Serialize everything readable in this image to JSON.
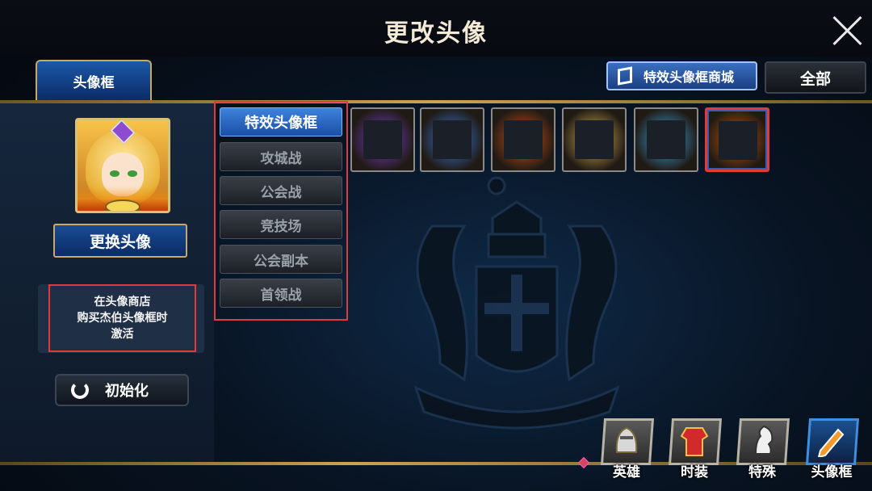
{
  "header": {
    "title": "更改头像"
  },
  "tabs": {
    "active_tab": "头像框",
    "shop_button": "特效头像框商城",
    "filter_button": "全部"
  },
  "left": {
    "change_avatar_button": "更换头像",
    "info_lines": [
      "在头像商店",
      "购买杰伯头像框时",
      "激活"
    ],
    "reset_button": "初始化"
  },
  "categories": [
    {
      "label": "特效头像框",
      "active": true
    },
    {
      "label": "攻城战",
      "active": false
    },
    {
      "label": "公会战",
      "active": false
    },
    {
      "label": "竞技场",
      "active": false
    },
    {
      "label": "公会副本",
      "active": false
    },
    {
      "label": "首领战",
      "active": false
    }
  ],
  "frames": [
    {
      "name": "purple-frame",
      "color": "#7b3fd0"
    },
    {
      "name": "blue-winged-frame",
      "color": "#3b7be0"
    },
    {
      "name": "flame-frame",
      "color": "#d6541c"
    },
    {
      "name": "golden-light-frame",
      "color": "#d9b25a"
    },
    {
      "name": "ice-horn-frame",
      "color": "#3aa6e6"
    },
    {
      "name": "eye-frame-selected",
      "color": "#c4560f"
    }
  ],
  "bottom_nav": [
    {
      "label": "英雄",
      "icon": "helmet-icon"
    },
    {
      "label": "时装",
      "icon": "costume-icon"
    },
    {
      "label": "特殊",
      "icon": "horse-icon"
    },
    {
      "label": "头像框",
      "icon": "pencil-frame-icon",
      "active": true
    }
  ]
}
